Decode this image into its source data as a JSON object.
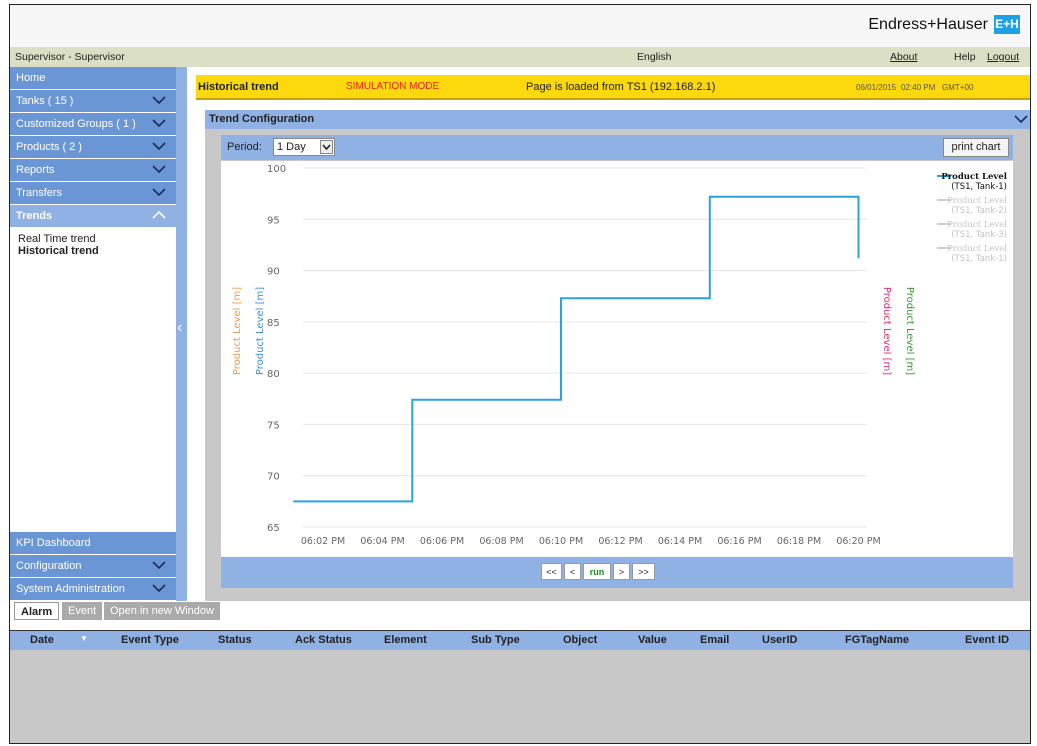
{
  "brand": {
    "name": "Endress+Hauser",
    "logo_text": "E+H"
  },
  "userbar": {
    "user": "Supervisor - Supervisor",
    "language": "English",
    "about": "About",
    "help": "Help",
    "logout": "Logout"
  },
  "sidebar": {
    "items": [
      {
        "label": "Home"
      },
      {
        "label": "Tanks ( 15 )"
      },
      {
        "label": "Customized Groups ( 1 )"
      },
      {
        "label": "Products ( 2 )"
      },
      {
        "label": "Reports"
      },
      {
        "label": "Transfers"
      },
      {
        "label": "Trends"
      }
    ],
    "trends_sub": [
      "Real Time trend",
      "Historical trend"
    ],
    "bottom_items": [
      {
        "label": "KPI Dashboard"
      },
      {
        "label": "Configuration"
      },
      {
        "label": "System Administration"
      }
    ]
  },
  "titlebar": {
    "title": "Historical trend",
    "mode": "SIMULATION MODE",
    "loaded": "Page is loaded from TS1 (192.168.2.1)",
    "date": "06/01/2015",
    "time": "02:40 PM",
    "tz": "GMT+00"
  },
  "panel": {
    "title": "Trend Configuration",
    "period_label": "Period:",
    "period_value": "1 Day",
    "print_button": "print chart"
  },
  "pager": {
    "first": "<<",
    "prev": "<",
    "run": "run",
    "next": ">",
    "last": ">>"
  },
  "alarm": {
    "tabs": [
      "Alarm",
      "Event",
      "Open in new Window"
    ],
    "columns": [
      "Date",
      "Event Type",
      "Status",
      "Ack Status",
      "Element",
      "Sub Type",
      "Object",
      "Value",
      "Email",
      "UserID",
      "FGTagName",
      "Event ID"
    ]
  },
  "colors": {
    "nav_blue": "#6b96d6",
    "light_blue": "#8fb1e3",
    "yellow": "#fcd90c",
    "series_blue": "#29a3e0",
    "mode_red": "#e8241f"
  },
  "chart_data": {
    "type": "line",
    "x": [
      "06:01 PM",
      "06:05 PM",
      "06:05 PM",
      "06:10 PM",
      "06:10 PM",
      "06:15 PM",
      "06:15 PM",
      "06:20 PM",
      "06:20 PM"
    ],
    "series": [
      {
        "name": "Product Level (TS1, Tank-1)",
        "values": [
          67.5,
          67.5,
          77.4,
          77.4,
          87.3,
          87.3,
          97.2,
          97.2,
          91.2
        ]
      }
    ],
    "x_ticks": [
      "06:02 PM",
      "06:04 PM",
      "06:06 PM",
      "06:08 PM",
      "06:10 PM",
      "06:12 PM",
      "06:14 PM",
      "06:16 PM",
      "06:18 PM",
      "06:20 PM"
    ],
    "y_ticks": [
      "65",
      "70",
      "75",
      "80",
      "85",
      "90",
      "95",
      "100"
    ],
    "ylim": [
      65,
      100
    ],
    "axis_labels": [
      "Product Level [m]",
      "Product Level [m]",
      "Product Level [m]",
      "Product Level [m]"
    ],
    "legend": [
      {
        "name": "Product Level",
        "sub": "(TS1, Tank-1)",
        "active": true
      },
      {
        "name": "Product Level",
        "sub": "(TS1, Tank-2)",
        "active": false
      },
      {
        "name": "Product Level",
        "sub": "(TS1, Tank-3)",
        "active": false
      },
      {
        "name": "Product Level",
        "sub": "(TS1, Tank-1)",
        "active": false
      }
    ],
    "legend_position": "top-right",
    "grid": true
  }
}
